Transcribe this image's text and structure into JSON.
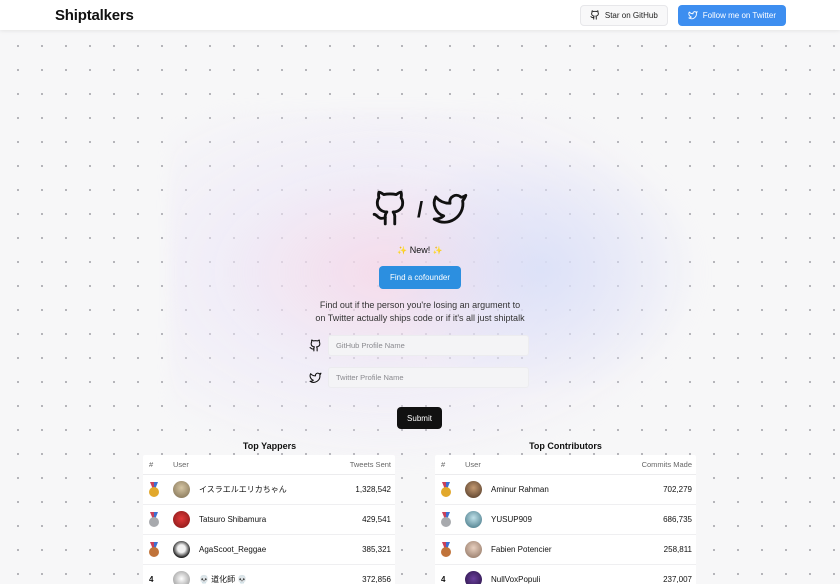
{
  "header": {
    "logo": "Shiptalkers",
    "github_button": "Star on GitHub",
    "twitter_button": "Follow me on Twitter"
  },
  "hero": {
    "icons": [
      "github-icon",
      "twitter-icon"
    ],
    "separator": "/",
    "new_label": "New!",
    "cofounder_button": "Find a cofounder",
    "tagline_line1": "Find out if the person you're losing an argument to",
    "tagline_line2": "on Twitter actually ships code or if it's all just shiptalk"
  },
  "form": {
    "github_placeholder": "GitHub Profile Name",
    "twitter_placeholder": "Twitter Profile Name",
    "submit": "Submit"
  },
  "yappers": {
    "title": "Top Yappers",
    "headers": {
      "rank": "#",
      "user": "User",
      "value": "Tweets Sent"
    },
    "rows": [
      {
        "rank": "1",
        "user": "イスラエルエリカちゃん",
        "value": "1,328,542"
      },
      {
        "rank": "2",
        "user": "Tatsuro Shibamura",
        "value": "429,541"
      },
      {
        "rank": "3",
        "user": "AgaScoot_Reggae",
        "value": "385,321"
      },
      {
        "rank": "4",
        "user": "💀 道化師 💀",
        "value": "372,856"
      }
    ]
  },
  "contributors": {
    "title": "Top Contributors",
    "headers": {
      "rank": "#",
      "user": "User",
      "value": "Commits Made"
    },
    "rows": [
      {
        "rank": "1",
        "user": "Aminur Rahman",
        "value": "702,279"
      },
      {
        "rank": "2",
        "user": "YUSUP909",
        "value": "686,735"
      },
      {
        "rank": "3",
        "user": "Fabien Potencier",
        "value": "258,811"
      },
      {
        "rank": "4",
        "user": "NullVoxPopuli",
        "value": "237,007"
      }
    ]
  },
  "colors": {
    "twitter_blue": "#3d8ef0",
    "cofounder_blue": "#2c8fe0",
    "submit_black": "#111111",
    "gold": "#e2a82c",
    "silver": "#a7a9ad",
    "bronze": "#c0733a"
  }
}
